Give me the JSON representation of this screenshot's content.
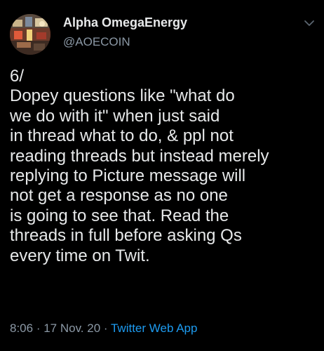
{
  "author": {
    "display_name": "Alpha OmegaEnergy",
    "handle": "@AOECOIN"
  },
  "tweet": {
    "lines": [
      "6/",
      "Dopey questions like \"what do",
      "we do with it\" when just said",
      "in thread what to do, & ppl not",
      "reading threads but instead merely",
      "replying to Picture message will",
      "not get a response as no one",
      "is going to see that. Read the",
      "threads in full before asking Qs",
      "every time on Twit."
    ]
  },
  "meta": {
    "time": "8:06",
    "separator": " · ",
    "date": "17 Nov. 20",
    "source": "Twitter Web App"
  },
  "colors": {
    "background": "#000000",
    "primary_text": "#e7e9ea",
    "secondary_text": "#8b98a5",
    "link": "#1d9bf0"
  },
  "icons": {
    "menu": "chevron-down-icon"
  }
}
